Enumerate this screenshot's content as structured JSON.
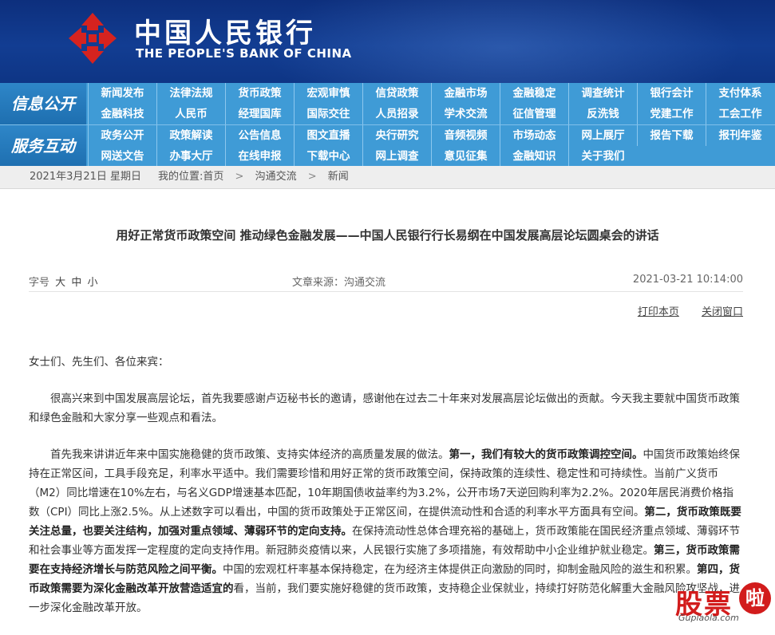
{
  "header": {
    "name_cn": "中国人民银行",
    "name_en": "THE PEOPLE'S BANK OF CHINA"
  },
  "nav": {
    "groups": [
      {
        "label": "信息公开",
        "rows": [
          [
            "新闻发布",
            "法律法规",
            "货币政策",
            "宏观审慎",
            "信贷政策",
            "金融市场",
            "金融稳定",
            "调查统计",
            "银行会计",
            "支付体系"
          ],
          [
            "金融科技",
            "人民币",
            "经理国库",
            "国际交往",
            "人员招录",
            "学术交流",
            "征信管理",
            "反洗钱",
            "党建工作",
            "工会工作"
          ]
        ]
      },
      {
        "label": "服务互动",
        "rows": [
          [
            "政务公开",
            "政策解读",
            "公告信息",
            "图文直播",
            "央行研究",
            "音频视频",
            "市场动态",
            "网上展厅",
            "报告下载",
            "报刊年鉴"
          ],
          [
            "网送文告",
            "办事大厅",
            "在线申报",
            "下载中心",
            "网上调查",
            "意见征集",
            "金融知识",
            "关于我们"
          ]
        ]
      }
    ]
  },
  "breadcrumb": {
    "date": "2021年3月21日 星期日",
    "prefix": "我的位置:首页",
    "sep": ">",
    "level1": "沟通交流",
    "level2": "新闻"
  },
  "article": {
    "title": "用好正常货币政策空间 推动绿色金融发展——中国人民银行行长易纲在中国发展高层论坛圆桌会的讲话",
    "font_label": "字号",
    "font_large": "大",
    "font_medium": "中",
    "font_small": "小",
    "source": "文章来源：沟通交流",
    "time": "2021-03-21 10:14:00",
    "print": "打印本页",
    "close": "关闭窗口",
    "greeting": "女士们、先生们、各位来宾：",
    "p1": "很高兴来到中国发展高层论坛，首先我要感谢卢迈秘书长的邀请，感谢他在过去二十年来对发展高层论坛做出的贡献。今天我主要就中国货币政策和绿色金融和大家分享一些观点和看法。",
    "p2_a": "首先我来讲讲近年来中国实施稳健的货币政策、支持实体经济的高质量发展的做法。",
    "p2_b1": "第一，我们有较大的货币政策调控空间。",
    "p2_c": "中国货币政策始终保持在正常区间，工具手段充足，利率水平适中。我们需要珍惜和用好正常的货币政策空间，保持政策的连续性、稳定性和可持续性。当前广义货币（M2）同比增速在10%左右，与名义GDP增速基本匹配，10年期国债收益率约为3.2%，公开市场7天逆回购利率为2.2%。2020年居民消费价格指数（CPI）同比上涨2.5%。从上述数字可以看出，中国的货币政策处于正常区间，在提供流动性和合适的利率水平方面具有空间。",
    "p2_b2": "第二，货币政策既要关注总量，也要关注结构，加强对重点领域、薄弱环节的定向支持。",
    "p2_d": "在保持流动性总体合理充裕的基础上，货币政策能在国民经济重点领域、薄弱环节和社会事业等方面发挥一定程度的定向支持作用。新冠肺炎疫情以来，人民银行实施了多项措施，有效帮助中小企业维护就业稳定。",
    "p2_b3": "第三，货币政策需要在支持经济增长与防范风险之间平衡。",
    "p2_e": "中国的宏观杠杆率基本保持稳定，在为经济主体提供正向激励的同时，抑制金融风险的滋生和积累。",
    "p2_b4": "第四，货币政策需要为深化金融改革开放营造适宜的",
    "p2_f": "看，当前，我们要实施好稳健的货币政策，支持稳企业保就业，持续打好防范化解重大金融风险攻坚战，进一步深化金融改革开放。"
  },
  "watermark": {
    "text": "股票",
    "circle": "啦",
    "url": "Gupiaola.com"
  },
  "colors": {
    "header_bg": "#123d92",
    "nav_bg": "#3f9bd6",
    "logo_red": "#d6231f",
    "watermark_red": "#d21c1c"
  }
}
